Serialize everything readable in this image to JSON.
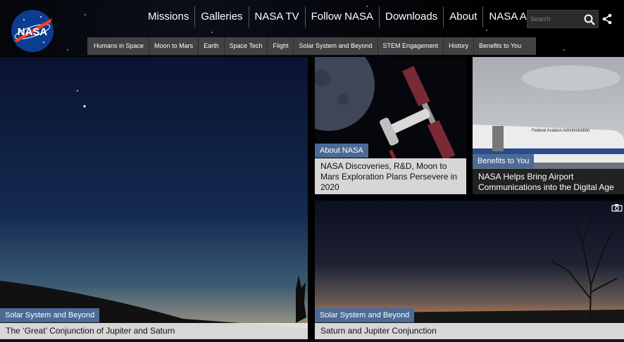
{
  "header": {
    "logo_alt": "NASA",
    "nav": [
      "Missions",
      "Galleries",
      "NASA TV",
      "Follow NASA",
      "Downloads",
      "About",
      "NASA Audiences"
    ],
    "search": {
      "placeholder": "Search"
    },
    "subnav": [
      "Humans in Space",
      "Moon to Mars",
      "Earth",
      "Space Tech",
      "Flight",
      "Solar System and Beyond",
      "STEM Engagement",
      "History",
      "Benefits to You"
    ]
  },
  "tiles": {
    "main": {
      "tag": "Solar System and Beyond",
      "caption": "The ‘Great’ Conjunction of Jupiter and Saturn"
    },
    "top_left": {
      "tag": "About NASA",
      "caption": "NASA Discoveries, R&D, Moon to Mars Exploration Plans Persevere in 2020"
    },
    "top_right": {
      "tag": "Benefits to You",
      "caption": "NASA Helps Bring Airport Communications into the Digital Age",
      "plane_text": "Federal Aviation Administration"
    },
    "bottom": {
      "tag": "Solar System and Beyond",
      "caption": "Saturn and Jupiter Conjunction"
    }
  },
  "colors": {
    "tag_bg": "#4c6a96",
    "subnav_bg": "#424242"
  },
  "icons": {
    "search": "search-icon",
    "share": "share-icon",
    "camera": "camera-icon"
  }
}
